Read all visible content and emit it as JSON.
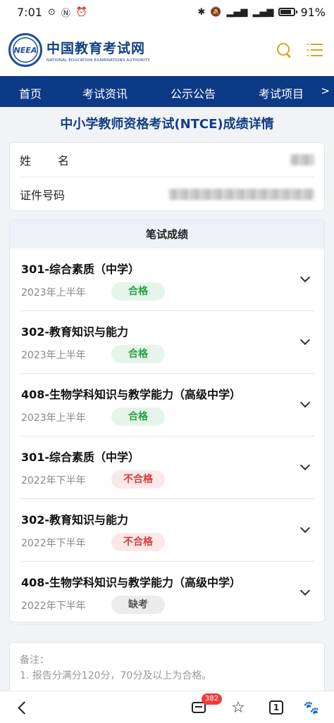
{
  "status": {
    "time": "7:01",
    "battery": "91%"
  },
  "header": {
    "logo_cn": "中国教育考试网",
    "logo_en": "NATIONAL EDUCATION EXAMINATIONS AUTHORITY",
    "logo_mark": "NEEA"
  },
  "nav": {
    "items": [
      "首页",
      "考试资讯",
      "公示公告",
      "考试项目"
    ],
    "more": ">"
  },
  "page_title": "中小学教师资格考试(NTCE)成绩详情",
  "info": {
    "name_label": "姓名",
    "id_label": "证件号码"
  },
  "scores": {
    "heading": "笔试成绩",
    "items": [
      {
        "subject": "301-综合素质（中学）",
        "period": "2023年上半年",
        "result": "合格"
      },
      {
        "subject": "302-教育知识与能力",
        "period": "2023年上半年",
        "result": "合格"
      },
      {
        "subject": "408-生物学科知识与教学能力（高级中学）",
        "period": "2023年上半年",
        "result": "合格"
      },
      {
        "subject": "301-综合素质（中学）",
        "period": "2022年下半年",
        "result": "不合格"
      },
      {
        "subject": "302-教育知识与能力",
        "period": "2022年下半年",
        "result": "不合格"
      },
      {
        "subject": "408-生物学科知识与教学能力（高级中学）",
        "period": "2022年下半年",
        "result": "缺考"
      }
    ]
  },
  "notes": {
    "label": "备注：",
    "line1": "1. 报告分满分120分，70分及以上为合格。"
  },
  "bottom_bar": {
    "comment_count": "382",
    "tab_count": "1"
  },
  "colors": {
    "brand": "#123e85",
    "nav_bg": "#0d3a87",
    "accent": "#e0a21f",
    "pass": "#25a244",
    "fail": "#d63b3b"
  }
}
